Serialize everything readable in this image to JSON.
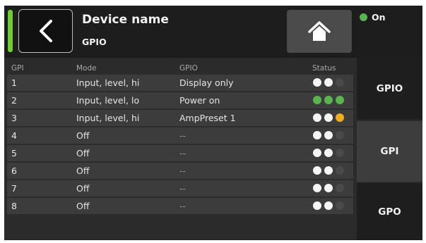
{
  "header": {
    "device_name": "Device name",
    "page_title": "GPIO",
    "power_status": "On",
    "icons": {
      "back": "chevron-left-icon",
      "home": "home-icon",
      "status": "status-dot-icon"
    },
    "colors": {
      "signal": "#6fcf2a",
      "on": "#5ab44e",
      "amber": "#f0ae1c"
    }
  },
  "table": {
    "columns": [
      "GPI",
      "Mode",
      "GPIO",
      "Status"
    ],
    "rows": [
      {
        "gpi": "1",
        "mode": "Input, level, hi",
        "gpio": "Display only",
        "status": [
          "white",
          "white",
          "dark"
        ]
      },
      {
        "gpi": "2",
        "mode": "Input, level, lo",
        "gpio": "Power on",
        "status": [
          "green",
          "green",
          "green"
        ]
      },
      {
        "gpi": "3",
        "mode": "Input, level, hi",
        "gpio": "AmpPreset 1",
        "status": [
          "white",
          "white",
          "amber"
        ]
      },
      {
        "gpi": "4",
        "mode": "Off",
        "gpio": "--",
        "status": [
          "white",
          "white",
          "dark"
        ]
      },
      {
        "gpi": "5",
        "mode": "Off",
        "gpio": "--",
        "status": [
          "white",
          "white",
          "dark"
        ]
      },
      {
        "gpi": "6",
        "mode": "Off",
        "gpio": "--",
        "status": [
          "white",
          "white",
          "dark"
        ]
      },
      {
        "gpi": "7",
        "mode": "Off",
        "gpio": "--",
        "status": [
          "white",
          "white",
          "dark"
        ]
      },
      {
        "gpi": "8",
        "mode": "Off",
        "gpio": "--",
        "status": [
          "white",
          "white",
          "dark"
        ]
      }
    ]
  },
  "tabs": [
    {
      "label": "GPIO",
      "selected": false
    },
    {
      "label": "GPI",
      "selected": true
    },
    {
      "label": "GPO",
      "selected": false
    }
  ]
}
